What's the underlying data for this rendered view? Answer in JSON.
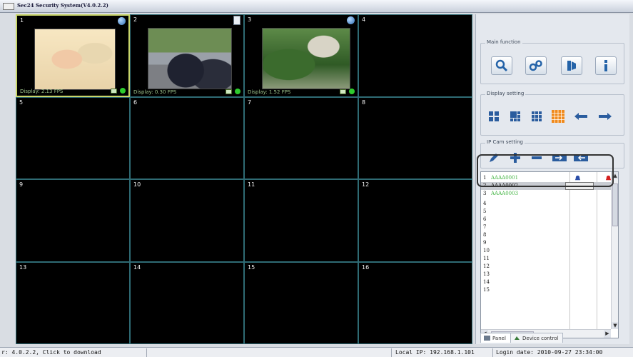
{
  "window": {
    "title": "Sec24 Security System(V4.0.2.2)"
  },
  "cells": [
    {
      "num": "1",
      "fps": "Display: 2.13 FPS",
      "active": true
    },
    {
      "num": "2",
      "fps": "Display: 0.30 FPS"
    },
    {
      "num": "3",
      "fps": "Display: 1.52 FPS"
    },
    {
      "num": "4"
    },
    {
      "num": "5"
    },
    {
      "num": "6"
    },
    {
      "num": "7"
    },
    {
      "num": "8"
    },
    {
      "num": "9"
    },
    {
      "num": "10"
    },
    {
      "num": "11"
    },
    {
      "num": "12"
    },
    {
      "num": "13"
    },
    {
      "num": "14"
    },
    {
      "num": "15"
    },
    {
      "num": "16"
    }
  ],
  "panel": {
    "main_function": "Main function",
    "display_setting": "Display setting",
    "ip_cam_setting": "IP Cam setting",
    "icons_main": [
      "search-icon",
      "settings-icon",
      "playback-icon",
      "info-icon"
    ],
    "icons_display": [
      "layout-4-icon",
      "layout-6-icon",
      "layout-9-icon",
      "layout-16-icon",
      "arrow-left-icon",
      "arrow-right-icon"
    ],
    "icons_ipcam": [
      "edit-icon",
      "add-icon",
      "remove-icon",
      "import-icon",
      "export-icon"
    ]
  },
  "camlist": {
    "rows": [
      {
        "idx": "1",
        "name": "AAAA0001",
        "color": "green"
      },
      {
        "idx": "2",
        "name": "AAAA0002",
        "color": "selected"
      },
      {
        "idx": "3",
        "name": "AAAA0003",
        "color": "green"
      },
      {
        "idx": "4",
        "name": ""
      },
      {
        "idx": "5",
        "name": ""
      },
      {
        "idx": "6",
        "name": ""
      },
      {
        "idx": "7",
        "name": ""
      },
      {
        "idx": "8",
        "name": ""
      },
      {
        "idx": "9",
        "name": ""
      },
      {
        "idx": "10",
        "name": ""
      },
      {
        "idx": "11",
        "name": ""
      },
      {
        "idx": "12",
        "name": ""
      },
      {
        "idx": "13",
        "name": ""
      },
      {
        "idx": "14",
        "name": ""
      },
      {
        "idx": "15",
        "name": ""
      }
    ]
  },
  "tabs": {
    "panel": "Panel",
    "device_control": "Device control"
  },
  "status": {
    "version": "r: 4.0.2.2, Click to download",
    "local_ip": "Local IP: 192.168.1.101",
    "login_date": "Login date: 2010-09-27 23:34:00"
  },
  "colors": {
    "accent_green": "#2ecc2e",
    "cell_border": "#2f6b74",
    "active_border": "#c9d66a"
  }
}
